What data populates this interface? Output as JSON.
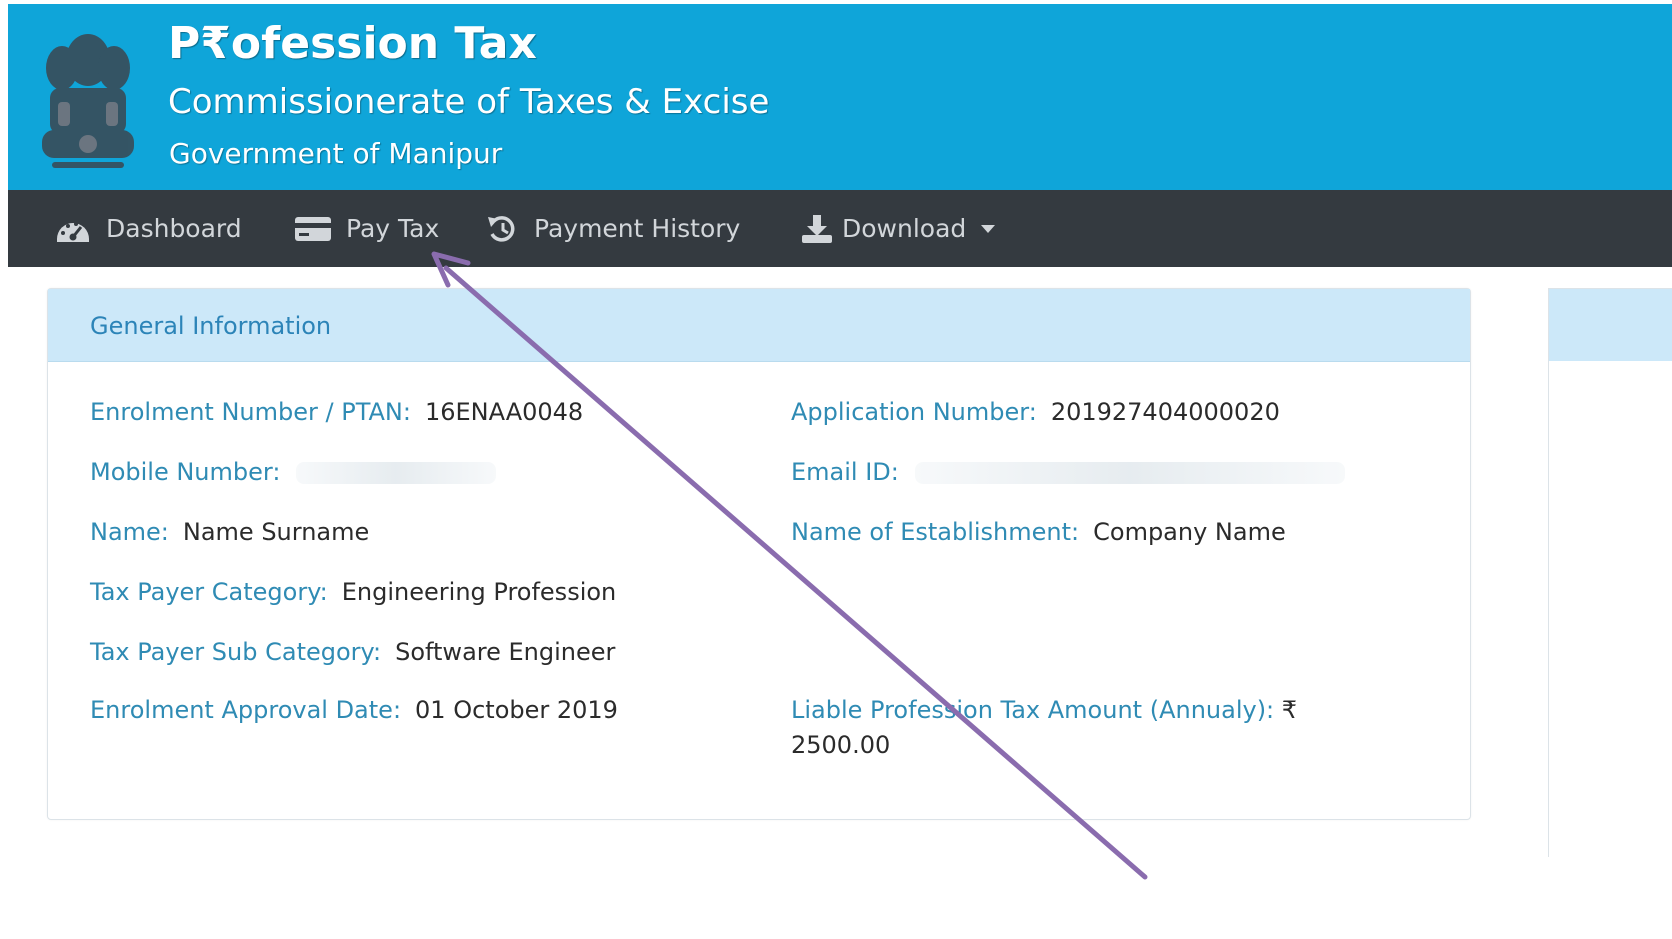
{
  "header": {
    "title": "P₹ofession Tax",
    "subtitle": "Commissionerate of Taxes & Excise",
    "government": "Government of Manipur",
    "emblem_icon": "state-emblem-icon"
  },
  "nav": {
    "items": [
      {
        "label": "Dashboard",
        "icon": "dashboard-gauge-icon"
      },
      {
        "label": "Pay Tax",
        "icon": "credit-card-icon"
      },
      {
        "label": "Payment History",
        "icon": "history-icon"
      },
      {
        "label": "Download",
        "icon": "download-icon"
      }
    ]
  },
  "general_info": {
    "title": "General Information",
    "enrolment_number_label": "Enrolment Number / PTAN:",
    "enrolment_number_value": "16ENAA0048",
    "application_number_label": "Application Number:",
    "application_number_value": "201927404000020",
    "mobile_label": "Mobile Number:",
    "email_label": "Email ID:",
    "name_label": "Name:",
    "name_value": "Name Surname",
    "establishment_label": "Name of Establishment:",
    "establishment_value": "Company Name",
    "category_label": "Tax Payer Category:",
    "category_value": "Engineering Profession",
    "sub_category_label": "Tax Payer Sub Category:",
    "sub_category_value": "Software Engineer",
    "approval_date_label": "Enrolment Approval Date:",
    "approval_date_value": "01 October 2019",
    "liable_amount_label": "Liable Profession Tax Amount (Annualy):",
    "liable_amount_currency": "₹",
    "liable_amount_value": "2500.00"
  },
  "colors": {
    "header_bg": "#0fa5d9",
    "navbar_bg": "#343a40",
    "card_header_bg": "#cce8f9",
    "label_color": "#2f8bb4",
    "annotation_arrow": "#8a6cae"
  }
}
